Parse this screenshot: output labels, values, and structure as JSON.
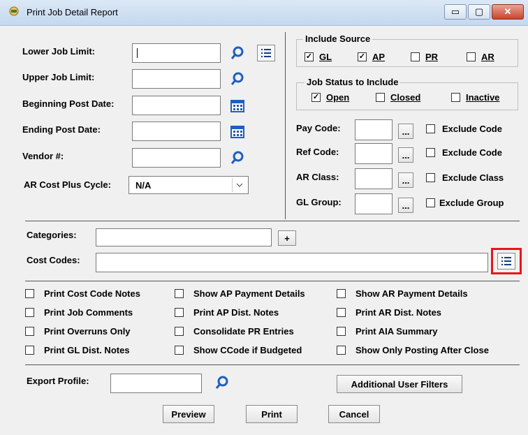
{
  "window": {
    "title": "Print Job Detail Report",
    "minimize": "▭",
    "maximize": "▢",
    "close": "✕"
  },
  "fields": {
    "lower_job_limit": {
      "label": "Lower Job Limit:",
      "value": ""
    },
    "upper_job_limit": {
      "label": "Upper Job Limit:",
      "value": ""
    },
    "beginning_post_date": {
      "label": "Beginning Post Date:",
      "value": ""
    },
    "ending_post_date": {
      "label": "Ending Post Date:",
      "value": ""
    },
    "vendor": {
      "label": "Vendor #:",
      "value": ""
    },
    "ar_cost_plus_cycle": {
      "label": "AR Cost Plus Cycle:",
      "value": "N/A"
    }
  },
  "include_source": {
    "title": "Include Source",
    "options": [
      {
        "label": "GL",
        "checked": true
      },
      {
        "label": "AP",
        "checked": true
      },
      {
        "label": "PR",
        "checked": false
      },
      {
        "label": "AR",
        "checked": false
      }
    ]
  },
  "job_status": {
    "title": "Job Status to Include",
    "options": [
      {
        "label": "Open",
        "checked": true
      },
      {
        "label": "Closed",
        "checked": false
      },
      {
        "label": "Inactive",
        "checked": false
      }
    ]
  },
  "codes": [
    {
      "label": "Pay Code:",
      "exclude": "Exclude Code"
    },
    {
      "label": "Ref Code:",
      "exclude": "Exclude Code"
    },
    {
      "label": "AR Class:",
      "exclude": "Exclude Class"
    },
    {
      "label": "GL Group:",
      "exclude": "Exclude Group"
    }
  ],
  "ellipsis": "...",
  "categories": {
    "label": "Categories:",
    "plus": "+"
  },
  "cost_codes": {
    "label": "Cost Codes:"
  },
  "options": [
    [
      "Print Cost Code Notes",
      "Show AP Payment Details",
      "Show AR Payment Details"
    ],
    [
      "Print Job Comments",
      "Print AP Dist. Notes",
      "Print AR Dist. Notes"
    ],
    [
      "Print Overruns Only",
      "Consolidate PR Entries",
      "Print AIA Summary"
    ],
    [
      "Print GL Dist. Notes",
      "Show CCode if Budgeted",
      "Show Only Posting After Close"
    ]
  ],
  "export_profile": {
    "label": "Export Profile:",
    "value": ""
  },
  "buttons": {
    "additional_filters": "Additional User Filters",
    "preview": "Preview",
    "print": "Print",
    "cancel": "Cancel"
  },
  "colors": {
    "highlight": "#e8161b",
    "accent": "#1f5fbf"
  }
}
